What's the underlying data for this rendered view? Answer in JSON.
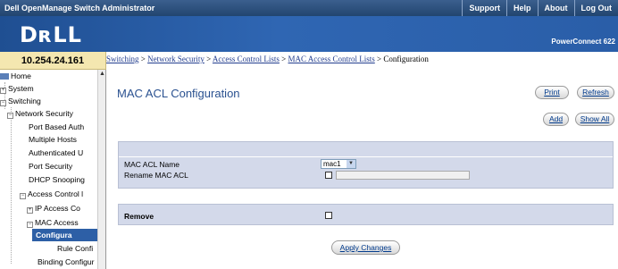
{
  "header": {
    "app_title": "Dell OpenManage Switch Administrator",
    "links": [
      "Support",
      "Help",
      "About",
      "Log Out"
    ],
    "logo": "DʀLL",
    "model": "PowerConnect 622"
  },
  "ip_address": "10.254.24.161",
  "breadcrumb": {
    "items": [
      "Switching",
      "Network Security",
      "Access Control Lists",
      "MAC Access Control Lists"
    ],
    "separator": ">",
    "current": "Configuration"
  },
  "tree": {
    "items": [
      {
        "label": "Home",
        "icon": "folder-icon"
      },
      {
        "label": "System",
        "icon": "expand-icon"
      },
      {
        "label": "Switching",
        "icon": "collapse-icon"
      },
      {
        "label": "Network Security",
        "icon": "collapse-icon"
      },
      {
        "label": "Port Based Auth"
      },
      {
        "label": "Multiple Hosts"
      },
      {
        "label": "Authenticated U"
      },
      {
        "label": "Port Security"
      },
      {
        "label": "DHCP Snooping"
      },
      {
        "label": "Access Control l",
        "icon": "collapse-icon"
      },
      {
        "label": "IP Access Co",
        "icon": "expand-icon"
      },
      {
        "label": "MAC Access",
        "icon": "collapse-icon"
      },
      {
        "label": "Configura",
        "selected": true
      },
      {
        "label": "Rule Confi"
      },
      {
        "label": "Binding Configur"
      }
    ]
  },
  "main": {
    "title": "MAC ACL Configuration",
    "buttons": {
      "print": "Print",
      "refresh": "Refresh",
      "add": "Add",
      "show_all": "Show All",
      "apply": "Apply Changes"
    },
    "form": {
      "mac_acl_name_label": "MAC ACL Name",
      "mac_acl_name_value": "mac1",
      "rename_label": "Rename MAC ACL",
      "rename_value": "",
      "remove_label": "Remove"
    }
  },
  "colors": {
    "header": "#22456f",
    "banner": "#2a5ea8",
    "title": "#2a5190",
    "panel": "#d3d9ea",
    "ip_box": "#f4e7b0",
    "selected": "#2d5fa6"
  }
}
